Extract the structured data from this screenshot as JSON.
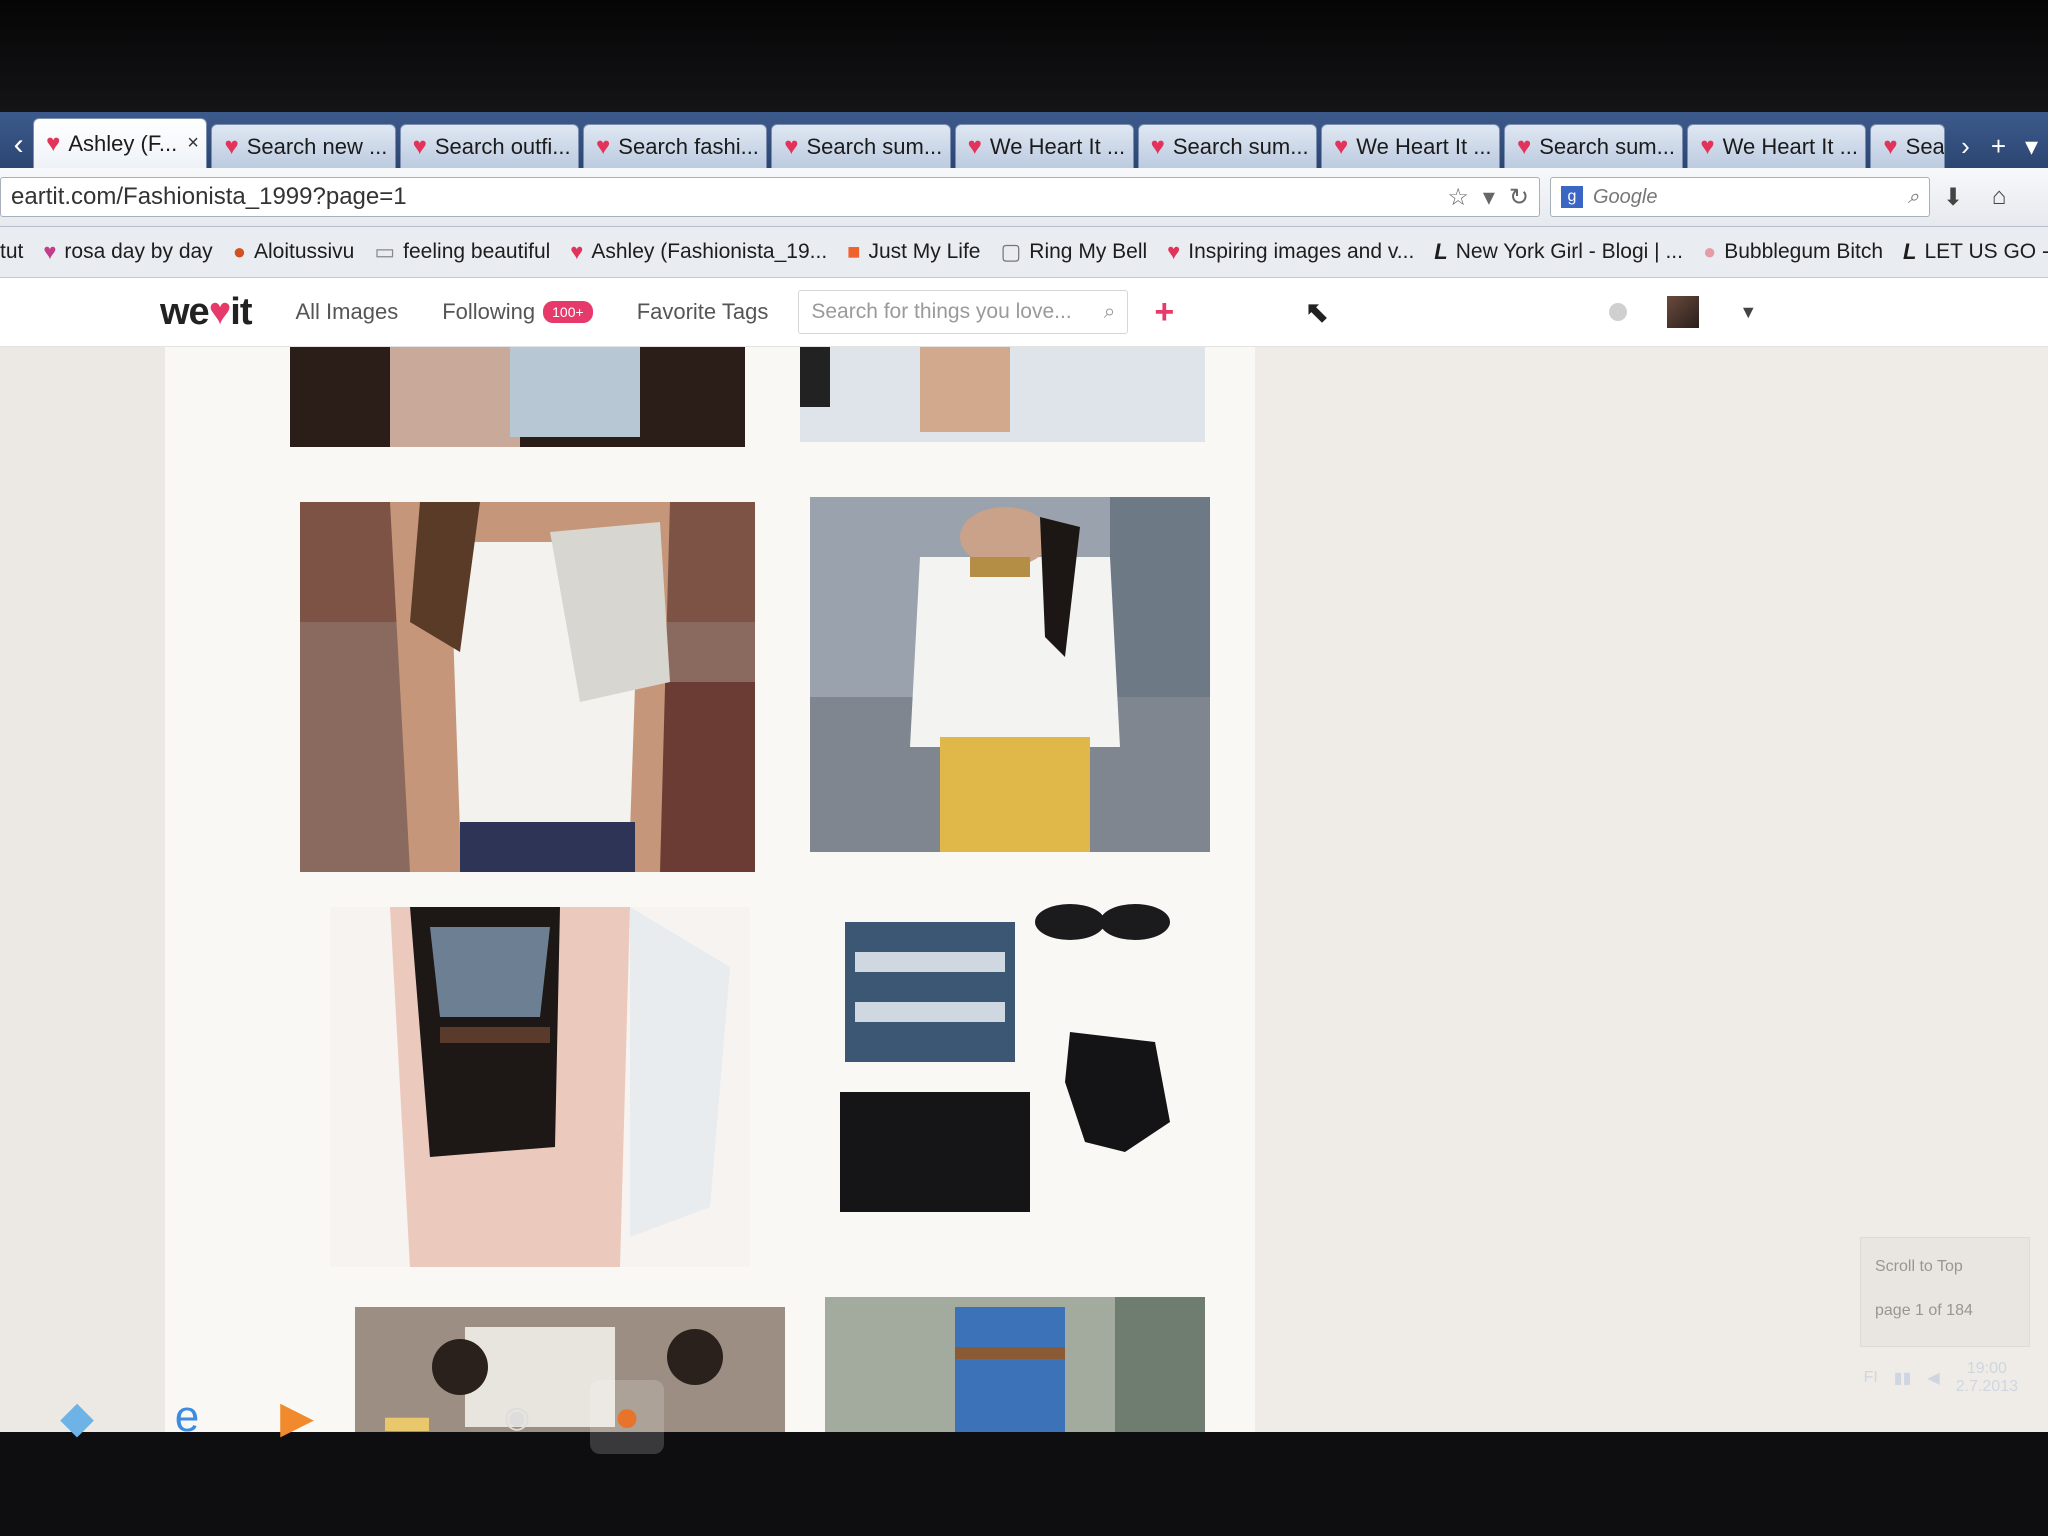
{
  "browser": {
    "tabs": [
      {
        "label": "Ashley (F...",
        "active": true,
        "icon": "heart-icon"
      },
      {
        "label": "Search new ...",
        "icon": "heart-icon"
      },
      {
        "label": "Search outfi...",
        "icon": "heart-icon"
      },
      {
        "label": "Search fashi...",
        "icon": "heart-icon"
      },
      {
        "label": "Search sum...",
        "icon": "heart-icon"
      },
      {
        "label": "We Heart It ...",
        "icon": "heart-icon"
      },
      {
        "label": "Search sum...",
        "icon": "heart-icon"
      },
      {
        "label": "We Heart It ...",
        "icon": "heart-icon"
      },
      {
        "label": "Search sum...",
        "icon": "heart-icon"
      },
      {
        "label": "We Heart It ...",
        "icon": "heart-icon"
      },
      {
        "label": "Searc",
        "icon": "heart-icon"
      }
    ],
    "tab_close": "×",
    "url": "eartit.com/Fashionista_1999?page=1",
    "search_engine_placeholder": "Google",
    "bookmarks": [
      {
        "label": "tut",
        "icon": "none"
      },
      {
        "label": "rosa day by day",
        "icon": "heart-icon"
      },
      {
        "label": "Aloitussivu",
        "icon": "firefox-icon"
      },
      {
        "label": "feeling beautiful",
        "icon": "page-icon"
      },
      {
        "label": "Ashley (Fashionista_19...",
        "icon": "heart-icon"
      },
      {
        "label": "Just My Life",
        "icon": "blogger-icon"
      },
      {
        "label": "Ring My Bell",
        "icon": "page-icon"
      },
      {
        "label": "Inspiring images and v...",
        "icon": "heart-icon"
      },
      {
        "label": "New York Girl - Blogi | ...",
        "icon": "blog-icon"
      },
      {
        "label": "Bubblegum Bitch",
        "icon": "dot-icon"
      },
      {
        "label": "LET US GO - Blogi |",
        "icon": "blog-icon"
      }
    ]
  },
  "site": {
    "logo": {
      "part1": "we",
      "heart": "♥",
      "part2": "it"
    },
    "nav": {
      "all_images": "All Images",
      "following": "Following",
      "following_badge": "100+",
      "favorite_tags": "Favorite Tags"
    },
    "search_placeholder": "Search for things you love...",
    "add_label": "+"
  },
  "scroll_widget": {
    "label": "Scroll to Top",
    "page": "page   1   of 184"
  },
  "tray": {
    "lang": "FI",
    "time": "19:00",
    "date": "2.7.2013"
  },
  "colors": {
    "brand": "#e63a6a",
    "tabstrip": "#2c4672"
  }
}
